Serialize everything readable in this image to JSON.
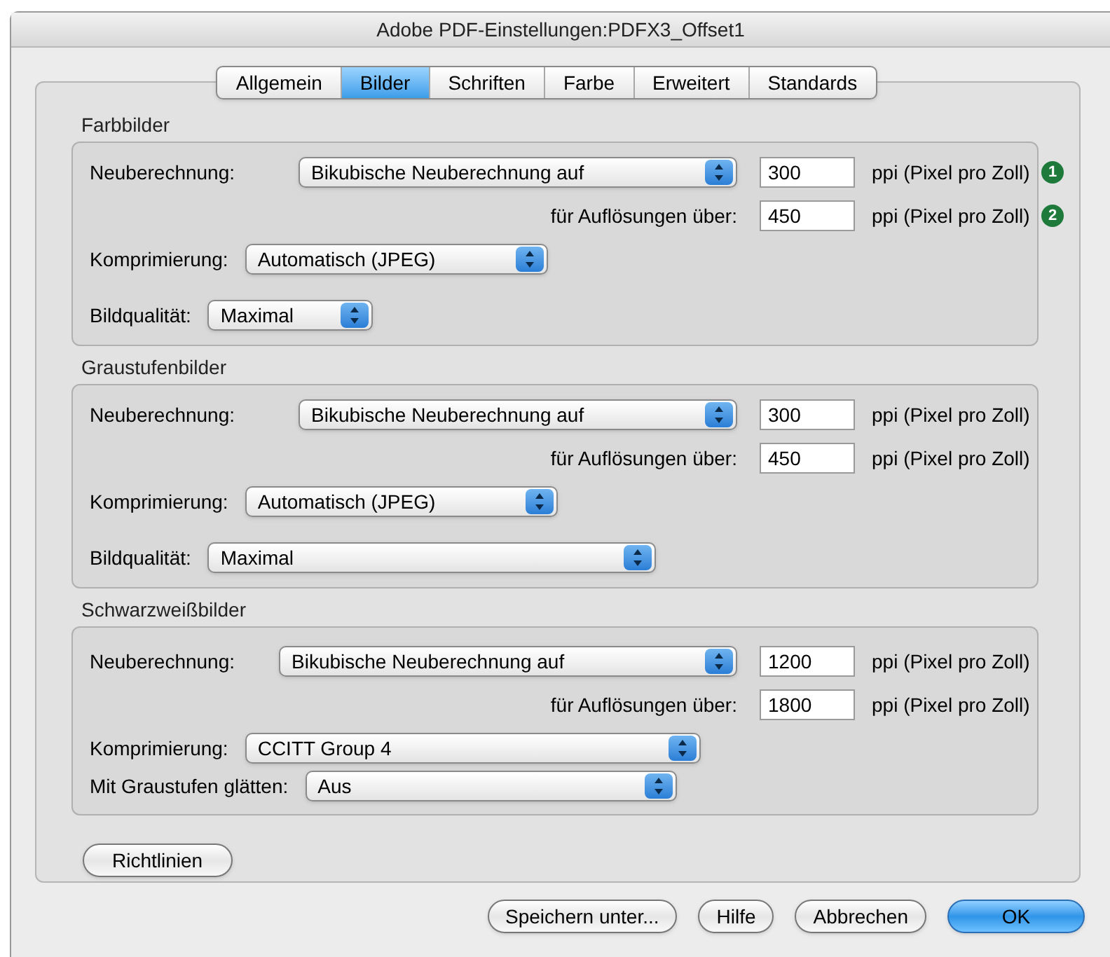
{
  "window": {
    "title": "Adobe PDF-Einstellungen:PDFX3_Offset1"
  },
  "tabs": [
    {
      "label": "Allgemein",
      "selected": false
    },
    {
      "label": "Bilder",
      "selected": true
    },
    {
      "label": "Schriften",
      "selected": false
    },
    {
      "label": "Farbe",
      "selected": false
    },
    {
      "label": "Erweitert",
      "selected": false
    },
    {
      "label": "Standards",
      "selected": false
    }
  ],
  "sections": [
    {
      "title": "Farbbilder",
      "rows": [
        {
          "kind": "resample",
          "label": "Neuberechnung:",
          "select": "Bikubische Neuberechnung auf",
          "value": "300",
          "unit": "ppi (Pixel pro Zoll)",
          "marker": "1"
        },
        {
          "kind": "threshold",
          "label": "für Auflösungen über:",
          "value": "450",
          "unit": "ppi (Pixel pro Zoll)",
          "marker": "2"
        },
        {
          "kind": "select",
          "label": "Komprimierung:",
          "select": "Automatisch (JPEG)"
        },
        {
          "kind": "select",
          "label": "Bildqualität:",
          "select": "Maximal"
        }
      ]
    },
    {
      "title": "Graustufenbilder",
      "rows": [
        {
          "kind": "resample",
          "label": "Neuberechnung:",
          "select": "Bikubische Neuberechnung auf",
          "value": "300",
          "unit": "ppi (Pixel pro Zoll)"
        },
        {
          "kind": "threshold",
          "label": "für Auflösungen über:",
          "value": "450",
          "unit": "ppi (Pixel pro Zoll)"
        },
        {
          "kind": "select",
          "label": "Komprimierung:",
          "select": "Automatisch (JPEG)"
        },
        {
          "kind": "select",
          "label": "Bildqualität:",
          "select": "Maximal"
        }
      ]
    },
    {
      "title": "Schwarzweißbilder",
      "rows": [
        {
          "kind": "resample",
          "label": "Neuberechnung:",
          "select": "Bikubische Neuberechnung auf",
          "value": "1200",
          "unit": "ppi (Pixel pro Zoll)"
        },
        {
          "kind": "threshold",
          "label": "für Auflösungen über:",
          "value": "1800",
          "unit": "ppi (Pixel pro Zoll)"
        },
        {
          "kind": "select",
          "label": "Komprimierung:",
          "select": "CCITT Group 4"
        },
        {
          "kind": "select",
          "label": "Mit Graustufen glätten:",
          "select": "Aus"
        }
      ]
    }
  ],
  "guidelines_button": "Richtlinien",
  "buttons": [
    {
      "label": "Speichern unter...",
      "kind": "normal"
    },
    {
      "label": "Hilfe",
      "kind": "normal"
    },
    {
      "label": "Abbrechen",
      "kind": "normal"
    },
    {
      "label": "OK",
      "kind": "default"
    }
  ]
}
